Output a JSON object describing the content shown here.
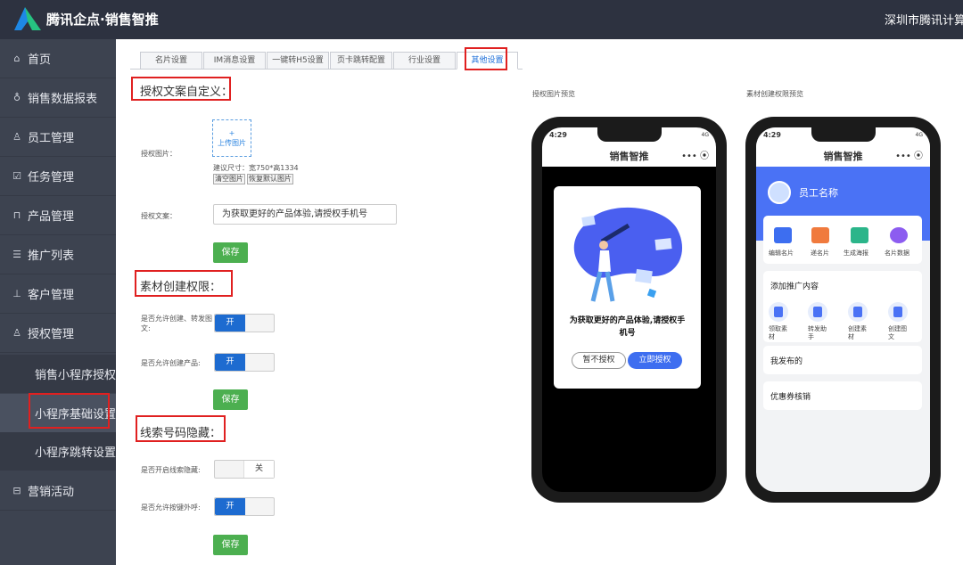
{
  "header": {
    "app_title": "腾讯企点·销售智推",
    "company": "深圳市腾讯计算机"
  },
  "sidebar": {
    "items": [
      {
        "label": "首页",
        "icon": "home-icon"
      },
      {
        "label": "销售数据报表",
        "icon": "person-chart-icon"
      },
      {
        "label": "员工管理",
        "icon": "user-icon"
      },
      {
        "label": "任务管理",
        "icon": "checkbox-icon"
      },
      {
        "label": "产品管理",
        "icon": "bag-icon"
      },
      {
        "label": "推广列表",
        "icon": "list-icon"
      },
      {
        "label": "客户管理",
        "icon": "org-icon"
      },
      {
        "label": "授权管理",
        "icon": "auth-user-icon"
      }
    ],
    "sub_items": [
      {
        "label": "销售小程序授权",
        "active": false
      },
      {
        "label": "小程序基础设置",
        "active": true
      },
      {
        "label": "小程序跳转设置",
        "active": false
      }
    ],
    "bottom_item": {
      "label": "营销活动",
      "icon": "briefcase-icon"
    }
  },
  "tabs": [
    {
      "label": "名片设置",
      "active": false
    },
    {
      "label": "IM消息设置",
      "active": false
    },
    {
      "label": "一键转H5设置",
      "active": false
    },
    {
      "label": "页卡跳转配置",
      "active": false
    },
    {
      "label": "行业设置",
      "active": false
    },
    {
      "label": "其他设置",
      "active": true
    }
  ],
  "auth_section": {
    "title": "授权文案自定义：",
    "image_label": "授权图片：",
    "upload_plus": "+",
    "upload_text": "上传图片",
    "size_hint": "建议尺寸：宽750*高1334",
    "clear_btn": "清空图片",
    "restore_btn": "恢复默认图片",
    "text_label": "授权文案：",
    "text_value": "为获取更好的产品体验,请授权手机号",
    "save": "保存"
  },
  "material_section": {
    "title": "素材创建权限：",
    "allow_create_label": "是否允许创建、转发图文:",
    "allow_create_state": "开",
    "allow_product_label": "是否允许创建产品:",
    "allow_product_state": "开",
    "save": "保存"
  },
  "clue_section": {
    "title": "线索号码隐藏：",
    "hide_label": "是否开启线索隐藏:",
    "hide_state": "关",
    "call_label": "是否允许按键外呼:",
    "call_state": "开",
    "save": "保存"
  },
  "preview_auth": {
    "caption": "授权图片预览",
    "time": "4:29",
    "signal": "4G",
    "title": "销售智推",
    "capsule": "•••  ⦿",
    "modal_text": "为获取更好的产品体验,请授权手机号",
    "deny": "暂不授权",
    "allow": "立即授权"
  },
  "preview_material": {
    "caption": "素材创建权限预览",
    "time": "4:29",
    "signal": "4G",
    "title": "销售智推",
    "capsule": "•••  ⦿",
    "employee_name": "员工名称",
    "grid": [
      "编辑名片",
      "递名片",
      "生成海报",
      "名片数据"
    ],
    "promo_title": "添加推广内容",
    "promo_items": [
      "领取素材",
      "转发助手",
      "创建素材",
      "创建图文"
    ],
    "my_posts": "我发布的",
    "coupon": "优惠券核销"
  },
  "colors": {
    "topbar": "#2d3240",
    "sidebar": "#3d4350",
    "accent_blue": "#1d6bd0",
    "save_green": "#4caf50",
    "annotation_red": "#e02020"
  }
}
